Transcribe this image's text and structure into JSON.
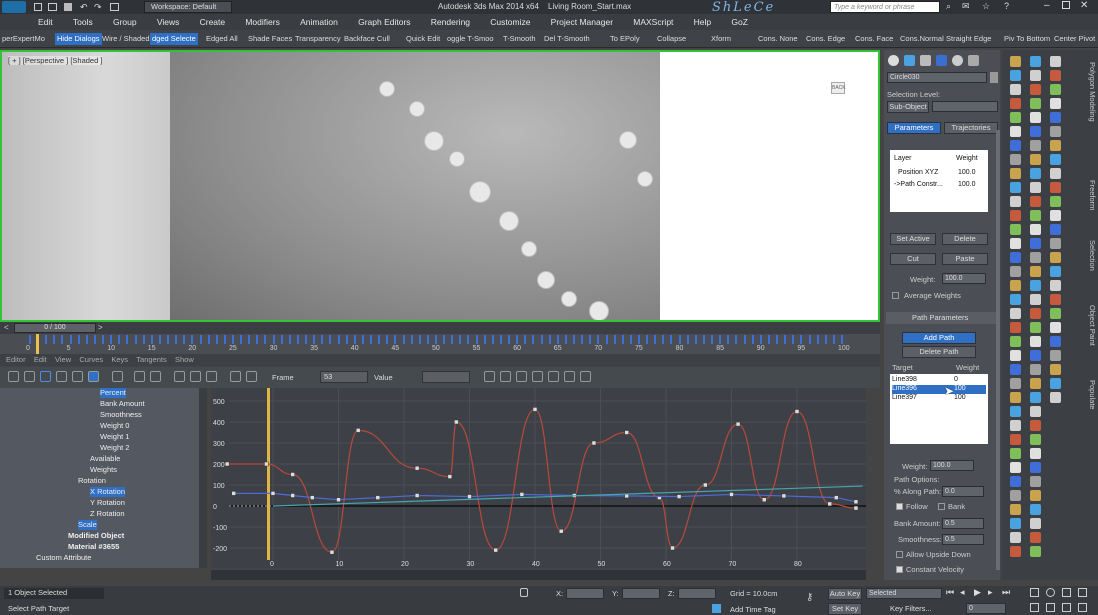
{
  "titlebar": {
    "workspace": "Workspace: Default",
    "app_title": "Autodesk 3ds Max 2014 x64",
    "file_name": "Living Room_Start.max",
    "search_placeholder": "Type a keyword or phrase"
  },
  "menu": [
    "Edit",
    "Tools",
    "Group",
    "Views",
    "Create",
    "Modifiers",
    "Animation",
    "Graph Editors",
    "Rendering",
    "Customize",
    "Project Manager",
    "MAXScript",
    "Help",
    "GoZ"
  ],
  "ribbon": {
    "items": [
      "perExpertMo",
      "Hide Dialogs",
      "Wire / Shaded",
      "dged Selecte",
      "Edged All",
      "Shade Faces",
      "Transparency",
      "Backface Cull",
      "Quick Edit",
      "oggle T-Smoo",
      "T-Smooth",
      "Del T-Smooth",
      "To EPoly",
      "Collapse",
      "Xform",
      "Cons. None",
      "Cons. Edge",
      "Cons. Face",
      "Cons.Normal",
      "Straight Edge",
      "Piv To Bottom",
      "Center Pivot"
    ]
  },
  "viewport": {
    "label": "[ + ] [Perspective ] [Shaded ]",
    "viewcube_label": "BACK"
  },
  "timeslider": {
    "label": "0 / 100"
  },
  "trackbar": {
    "ticks": [
      "0",
      "5",
      "10",
      "15",
      "20",
      "25",
      "30",
      "35",
      "40",
      "45",
      "50",
      "55",
      "60",
      "65",
      "70",
      "75",
      "80",
      "85",
      "90",
      "95",
      "100"
    ]
  },
  "curve_menu": [
    "Editor",
    "Edit",
    "View",
    "Curves",
    "Keys",
    "Tangents",
    "Show"
  ],
  "curve_toolbar": {
    "frame_label": "Frame",
    "frame_value": "53",
    "value_label": "Value",
    "value_value": ""
  },
  "tree": {
    "items": [
      {
        "label": "Percent",
        "selected": true
      },
      {
        "label": "Bank Amount",
        "selected": false
      },
      {
        "label": "Smoothness",
        "selected": false
      },
      {
        "label": "Weight 0",
        "selected": false
      },
      {
        "label": "Weight 1",
        "selected": false
      },
      {
        "label": "Weight 2",
        "selected": false
      },
      {
        "label": "Available",
        "selected": false
      },
      {
        "label": "Weights",
        "selected": false
      },
      {
        "label": "Rotation",
        "selected": false
      },
      {
        "label": "X Rotation",
        "selected": true
      },
      {
        "label": "Y Rotation",
        "selected": false
      },
      {
        "label": "Z Rotation",
        "selected": false
      },
      {
        "label": "Scale",
        "selected": true
      },
      {
        "label": "Modified Object",
        "selected": false
      },
      {
        "label": "Material #3655",
        "selected": false
      },
      {
        "label": "Custom Attribute",
        "selected": false
      }
    ]
  },
  "graph": {
    "y_ticks": [
      "500",
      "400",
      "300",
      "200",
      "100",
      "0",
      "-100",
      "-200"
    ],
    "x_ticks": [
      "0",
      "10",
      "20",
      "30",
      "40",
      "50",
      "60",
      "70",
      "80"
    ]
  },
  "command_panel": {
    "object_name": "Circle030",
    "selection_level_label": "Selection Level:",
    "subobject_label": "Sub-Object",
    "tab_parameters": "Parameters",
    "tab_trajectories": "Trajectories",
    "layer_header": "Layer",
    "weight_header": "Weight",
    "layers": [
      {
        "name": "Position XYZ",
        "weight": "100.0"
      },
      {
        "name": "->Path Constr...",
        "weight": "100.0"
      }
    ],
    "set_active": "Set Active",
    "delete": "Delete",
    "cut": "Cut",
    "paste": "Paste",
    "weight_label": "Weight:",
    "weight_value": "100.0",
    "average_weights": "Average Weights",
    "path_params_title": "Path Parameters",
    "add_path": "Add Path",
    "delete_path": "Delete Path",
    "target_header": "Target",
    "target_weight_header": "Weight",
    "targets": [
      {
        "name": "Line398",
        "weight": "0",
        "selected": false
      },
      {
        "name": "Line396",
        "weight": "100",
        "selected": true
      },
      {
        "name": "Line397",
        "weight": "100",
        "selected": false
      }
    ],
    "weight2_label": "Weight:",
    "weight2_value": "100.0",
    "path_options": "Path Options:",
    "along_path_label": "% Along Path:",
    "along_path_value": "0.0",
    "follow": "Follow",
    "bank": "Bank",
    "bank_amount_label": "Bank Amount:",
    "bank_amount_value": "0.5",
    "smoothness_label": "Smoothness:",
    "smoothness_value": "0.5",
    "allow_upside_down": "Allow Upside Down",
    "constant_velocity": "Constant Velocity"
  },
  "status": {
    "selected": "1 Object Selected",
    "prompt": "Select Path Target",
    "x_label": "X:",
    "y_label": "Y:",
    "z_label": "Z:",
    "grid": "Grid = 10.0cm",
    "auto_key": "Auto Key",
    "auto_key_mode": "Selected",
    "set_key": "Set Key",
    "key_filters": "Key Filters...",
    "add_time_tag": "Add Time Tag",
    "frame_value": "0"
  },
  "colors": {
    "accent": "#2f6fc4",
    "viewport_border": "#34c334",
    "curve_red": "#b8493a",
    "curve_blue": "#4d6bdc",
    "curve_cyan": "#46a6b0"
  }
}
